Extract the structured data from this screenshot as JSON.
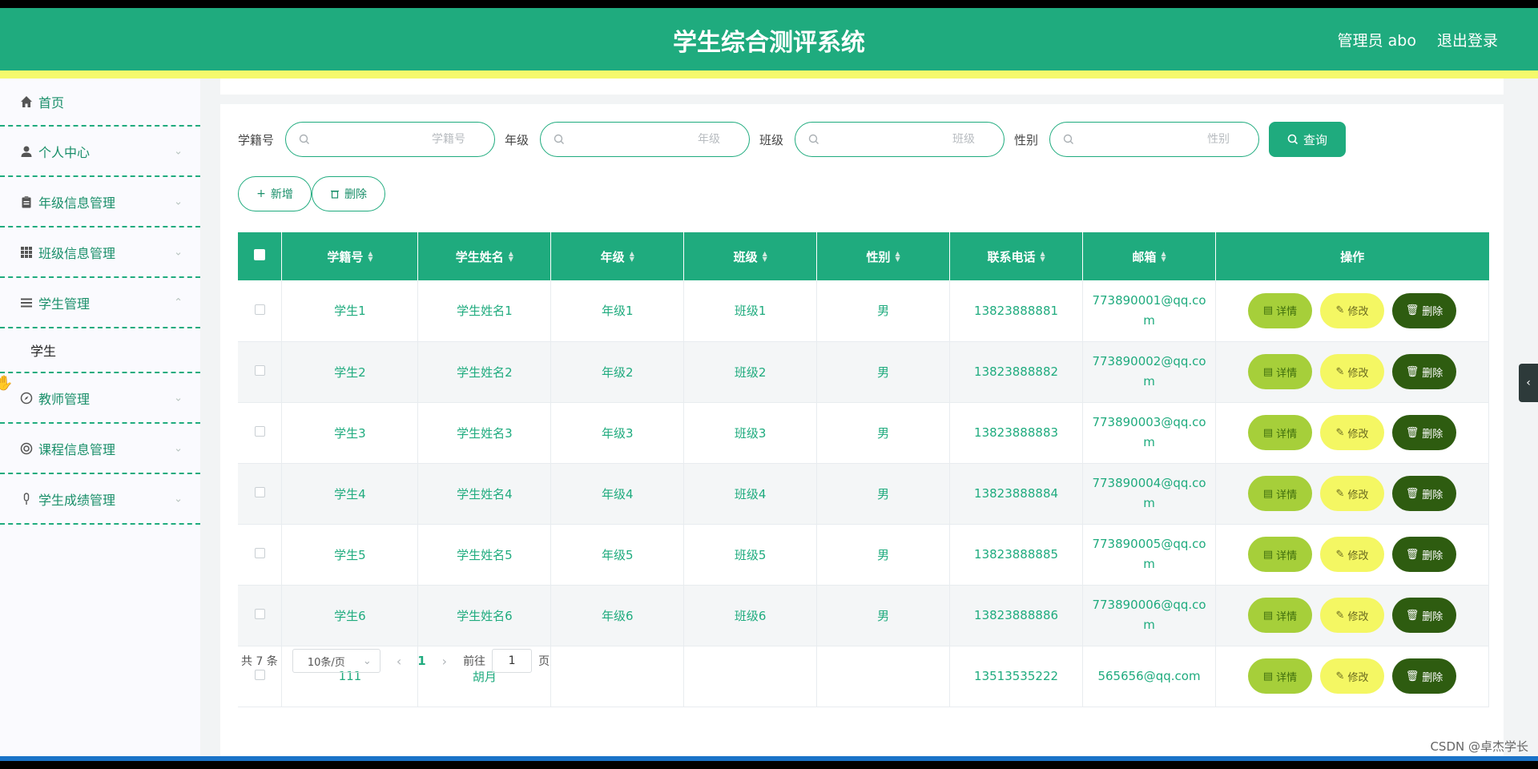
{
  "header": {
    "title": "学生综合测评系统",
    "user": "管理员 abo",
    "logout": "退出登录"
  },
  "sidebar": {
    "items": [
      {
        "label": "首页",
        "icon": "home-icon"
      },
      {
        "label": "个人中心",
        "icon": "user-icon"
      },
      {
        "label": "年级信息管理",
        "icon": "clipboard-icon"
      },
      {
        "label": "班级信息管理",
        "icon": "grid-icon"
      },
      {
        "label": "学生管理",
        "icon": "list-icon"
      },
      {
        "label": "教师管理",
        "icon": "compass-icon"
      },
      {
        "label": "课程信息管理",
        "icon": "lifebuoy-icon"
      },
      {
        "label": "学生成绩管理",
        "icon": "mic-icon"
      }
    ],
    "submenu": "学生"
  },
  "search": {
    "fields": [
      {
        "label": "学籍号",
        "placeholder": "学籍号"
      },
      {
        "label": "年级",
        "placeholder": "年级"
      },
      {
        "label": "班级",
        "placeholder": "班级"
      },
      {
        "label": "性别",
        "placeholder": "性别"
      }
    ],
    "query_label": "查询"
  },
  "actions": {
    "add_label": "新增",
    "delete_label": "删除"
  },
  "table": {
    "headers": [
      "学籍号",
      "学生姓名",
      "年级",
      "班级",
      "性别",
      "联系电话",
      "邮箱",
      "操作"
    ],
    "rows": [
      {
        "id": "学生1",
        "name": "学生姓名1",
        "grade": "年级1",
        "class": "班级1",
        "gender": "男",
        "phone": "13823888881",
        "email_a": "773890001@qq.co",
        "email_b": "m"
      },
      {
        "id": "学生2",
        "name": "学生姓名2",
        "grade": "年级2",
        "class": "班级2",
        "gender": "男",
        "phone": "13823888882",
        "email_a": "773890002@qq.co",
        "email_b": "m"
      },
      {
        "id": "学生3",
        "name": "学生姓名3",
        "grade": "年级3",
        "class": "班级3",
        "gender": "男",
        "phone": "13823888883",
        "email_a": "773890003@qq.co",
        "email_b": "m"
      },
      {
        "id": "学生4",
        "name": "学生姓名4",
        "grade": "年级4",
        "class": "班级4",
        "gender": "男",
        "phone": "13823888884",
        "email_a": "773890004@qq.co",
        "email_b": "m"
      },
      {
        "id": "学生5",
        "name": "学生姓名5",
        "grade": "年级5",
        "class": "班级5",
        "gender": "男",
        "phone": "13823888885",
        "email_a": "773890005@qq.co",
        "email_b": "m"
      },
      {
        "id": "学生6",
        "name": "学生姓名6",
        "grade": "年级6",
        "class": "班级6",
        "gender": "男",
        "phone": "13823888886",
        "email_a": "773890006@qq.co",
        "email_b": "m"
      },
      {
        "id": "111",
        "name": "胡月",
        "grade": "",
        "class": "",
        "gender": "",
        "phone": "13513535222",
        "email_a": "565656@qq.com",
        "email_b": ""
      }
    ],
    "op_detail": "详情",
    "op_edit": "修改",
    "op_delete": "删除"
  },
  "pagination": {
    "total": "共 7 条",
    "page_size": "10条/页",
    "current": "1",
    "goto_prefix": "前往",
    "goto_value": "1",
    "goto_suffix": "页"
  },
  "watermark": "CSDN @卓杰学长",
  "colors": {
    "primary": "#1fab7e",
    "accent_strip": "#f5f96c",
    "detail": "#a6cf3a",
    "edit": "#f4f763",
    "delete": "#2e5c10"
  }
}
